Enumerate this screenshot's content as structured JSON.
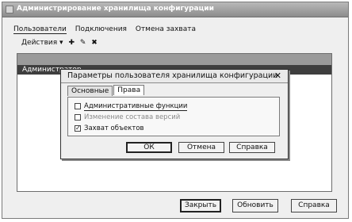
{
  "window": {
    "title": "Администрирование хранилища конфигурации"
  },
  "tabs": [
    {
      "label": "Пользователи"
    },
    {
      "label": "Подключения"
    },
    {
      "label": "Отмена захвата"
    }
  ],
  "toolbar": {
    "actions_label": "Действия ▾",
    "add_icon_glyph": "✚",
    "edit_icon_glyph": "✎",
    "delete_icon_glyph": "✖"
  },
  "list": {
    "rows": [
      {
        "name": "Администратор"
      }
    ]
  },
  "dialog": {
    "title": "Параметры пользователя хранилища конфигурации",
    "close_glyph": "✕",
    "tabs": [
      {
        "label": "Основные"
      },
      {
        "label": "Права"
      }
    ],
    "rights": [
      {
        "label": "Административные функции",
        "checked": false
      },
      {
        "label": "Изменение состава версий",
        "checked": false
      },
      {
        "label": "Захват объектов",
        "checked": true
      }
    ],
    "ok_label": "ОК",
    "cancel_label": "Отмена",
    "help_label": "Справка"
  },
  "footer": {
    "close_label": "Закрыть",
    "refresh_label": "Обновить",
    "help_label": "Справка"
  }
}
